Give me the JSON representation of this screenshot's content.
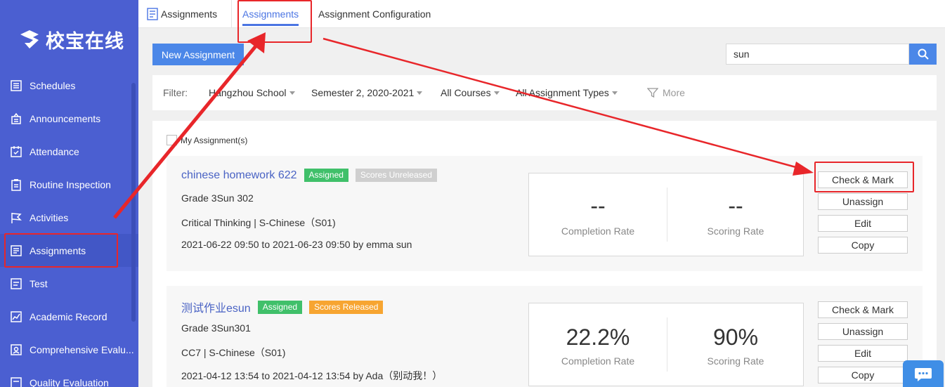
{
  "brand": {
    "name": "校宝在线"
  },
  "sidebar": {
    "items": [
      {
        "label": "Schedules",
        "icon": "schedules-icon"
      },
      {
        "label": "Announcements",
        "icon": "announcements-icon"
      },
      {
        "label": "Attendance",
        "icon": "attendance-icon"
      },
      {
        "label": "Routine Inspection",
        "icon": "inspection-icon"
      },
      {
        "label": "Activities",
        "icon": "flag-icon"
      },
      {
        "label": "Assignments",
        "icon": "assignments-icon",
        "active": true
      },
      {
        "label": "Test",
        "icon": "test-icon"
      },
      {
        "label": "Academic Record",
        "icon": "chart-icon"
      },
      {
        "label": "Comprehensive Evalu...",
        "icon": "evaluation-icon"
      },
      {
        "label": "Quality Evaluation",
        "icon": "quality-icon"
      }
    ]
  },
  "topbar": {
    "tabs": [
      {
        "label": "Assignments"
      },
      {
        "label": "Assignments",
        "active": true
      },
      {
        "label": "Assignment Configuration"
      }
    ]
  },
  "toolbar": {
    "new_label": "New Assignment",
    "search_value": "sun"
  },
  "filter": {
    "label": "Filter:",
    "school": "Hangzhou School",
    "semester": "Semester 2, 2020-2021",
    "courses": "All Courses",
    "types": "All Assignment Types",
    "more": "More"
  },
  "list": {
    "my_assignments_label": "My Assignment(s)",
    "cards": [
      {
        "title": "chinese homework 622",
        "badges": [
          "Assigned",
          "Scores Unreleased"
        ],
        "class": "Grade 3Sun 302",
        "course": "Critical Thinking | S-Chinese（S01)",
        "time": "2021-06-22 09:50 to 2021-06-23 09:50 by emma sun",
        "completion": "--",
        "scoring": "--",
        "completion_label": "Completion Rate",
        "scoring_label": "Scoring Rate",
        "actions": [
          "Check & Mark",
          "Unassign",
          "Edit",
          "Copy"
        ]
      },
      {
        "title": "测试作业esun",
        "badges": [
          "Assigned",
          "Scores Released"
        ],
        "class": "Grade 3Sun301",
        "course": "CC7 | S-Chinese（S01)",
        "time": "2021-04-12 13:54 to 2021-04-12 13:54 by Ada（别动我！）",
        "completion": "22.2%",
        "scoring": "90%",
        "completion_label": "Completion Rate",
        "scoring_label": "Scoring Rate",
        "actions": [
          "Check & Mark",
          "Unassign",
          "Edit",
          "Copy"
        ]
      }
    ]
  },
  "colors": {
    "sidebar": "#4b5fd1",
    "accent": "#4b87e8",
    "assigned": "#40c06a",
    "unreleased": "#cfcfcf",
    "released": "#f7a531",
    "annotation": "#e8262a"
  }
}
